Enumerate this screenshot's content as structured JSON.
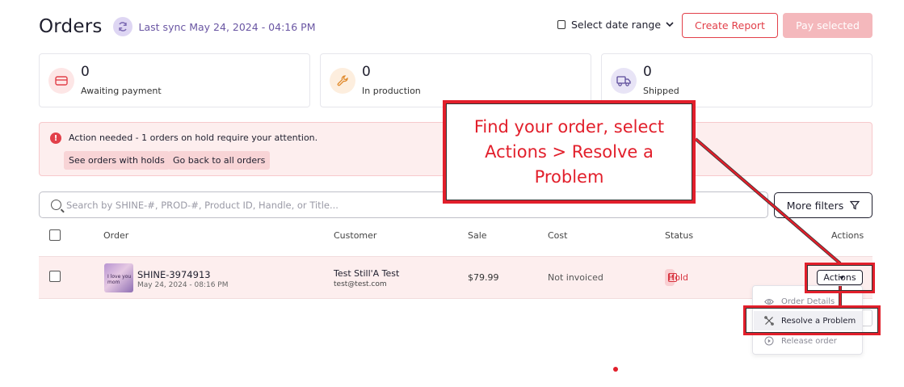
{
  "header": {
    "title": "Orders",
    "sync_text": "Last sync May 24, 2024 - 04:16 PM",
    "date_range_label": "Select date range",
    "create_report_label": "Create Report",
    "pay_selected_label": "Pay selected"
  },
  "stats": [
    {
      "value": "0",
      "label": "Awaiting payment",
      "icon": "credit-card-icon"
    },
    {
      "value": "0",
      "label": "In production",
      "icon": "wrench-icon"
    },
    {
      "value": "0",
      "label": "Shipped",
      "icon": "truck-icon"
    }
  ],
  "alert": {
    "message": "Action needed - 1 orders on hold require your attention.",
    "button_holds": "See orders with holds",
    "button_all": "Go back to all orders"
  },
  "search": {
    "placeholder": "Search by SHINE-#, PROD-#, Product ID, Handle, or Title...",
    "value": ""
  },
  "filters_label": "More filters",
  "table": {
    "columns": {
      "order": "Order",
      "customer": "Customer",
      "sale": "Sale",
      "cost": "Cost",
      "status": "Status",
      "actions": "Actions"
    },
    "rows": [
      {
        "thumb_text": "I love you mom",
        "order_id": "SHINE-3974913",
        "date": "May 24, 2024 - 08:16 PM",
        "customer_name": "Test Still'A Test",
        "customer_email": "test@test.com",
        "sale": "$79.99",
        "cost": "Not invoiced",
        "status": "Hold",
        "actions_label": "Actions"
      }
    ]
  },
  "actions_menu": [
    {
      "label": "Order Details",
      "icon": "eye-icon"
    },
    {
      "label": "Resolve a Problem",
      "icon": "tools-icon"
    },
    {
      "label": "Release order",
      "icon": "play-circle-icon"
    }
  ],
  "callout": {
    "text": "Find your order, select Actions > Resolve a Problem"
  },
  "colors": {
    "brand_red": "#e2404a",
    "annotation_red": "#e21f2b",
    "sync_purple": "#6a56a3",
    "alert_bg": "#fdeeee"
  }
}
